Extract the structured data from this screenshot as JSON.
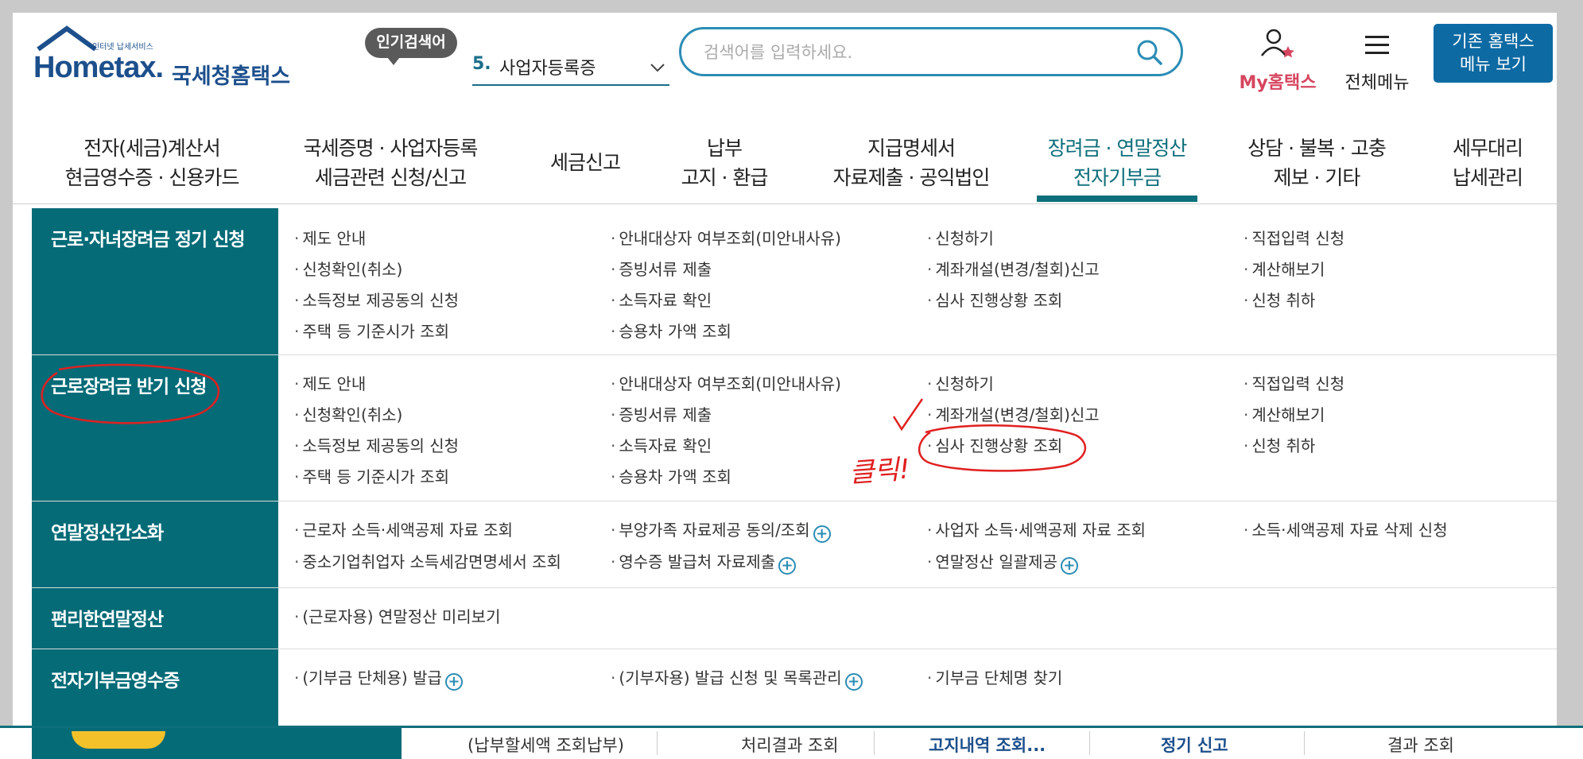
{
  "header": {
    "logo_sub": "인터넷 납세서비스",
    "logo_main": "Hometax.",
    "logo_tail": "국세청홈택스",
    "popular_badge": "인기검색어",
    "popular_rank": "5.",
    "popular_term": "사업자등록증",
    "search_placeholder": "검색어를 입력하세요.",
    "my_label": "My홈택스",
    "allmenu_label": "전체메뉴",
    "legacy_line1": "기존 홈택스",
    "legacy_line2": "메뉴 보기"
  },
  "nav": {
    "items": [
      {
        "line1": "전자(세금)계산서",
        "line2": "현금영수증 · 신용카드"
      },
      {
        "line1": "국세증명 · 사업자등록",
        "line2": "세금관련 신청/신고"
      },
      {
        "line1": "세금신고",
        "line2": ""
      },
      {
        "line1": "납부",
        "line2": "고지 · 환급"
      },
      {
        "line1": "지급명세서",
        "line2": "자료제출 · 공익법인"
      },
      {
        "line1": "장려금 · 연말정산",
        "line2": "전자기부금"
      },
      {
        "line1": "상담 · 불복 · 고충",
        "line2": "제보 · 기타"
      },
      {
        "line1": "세무대리",
        "line2": "납세관리"
      }
    ]
  },
  "menu": {
    "rows": [
      {
        "title": "근로·자녀장려금 정기 신청",
        "links": [
          "제도 안내",
          "안내대상자 여부조회(미안내사유)",
          "신청하기",
          "직접입력 신청",
          "신청확인(취소)",
          "증빙서류 제출",
          "계좌개설(변경/철회)신고",
          "계산해보기",
          "소득정보 제공동의 신청",
          "소득자료 확인",
          "심사 진행상황 조회",
          "신청 취하",
          "주택 등 기준시가 조회",
          "승용차 가액 조회"
        ]
      },
      {
        "title": "근로장려금 반기 신청",
        "links": [
          "제도 안내",
          "안내대상자 여부조회(미안내사유)",
          "신청하기",
          "직접입력 신청",
          "신청확인(취소)",
          "증빙서류 제출",
          "계좌개설(변경/철회)신고",
          "계산해보기",
          "소득정보 제공동의 신청",
          "소득자료 확인",
          "심사 진행상황 조회",
          "신청 취하",
          "주택 등 기준시가 조회",
          "승용차 가액 조회"
        ]
      },
      {
        "title": "연말정산간소화",
        "links": [
          "근로자 소득·세액공제 자료 조회",
          "부양가족 자료제공 동의/조회",
          "사업자 소득·세액공제 자료 조회",
          "소득·세액공제 자료 삭제 신청",
          "중소기업취업자 소득세감면명세서 조회",
          "영수증 발급처 자료제출",
          "연말정산 일괄제공"
        ]
      },
      {
        "title": "편리한연말정산",
        "links": [
          "(근로자용) 연말정산 미리보기"
        ]
      },
      {
        "title": "전자기부금영수증",
        "links": [
          "(기부금 단체용) 발급",
          "(기부자용) 발급 신청 및 목록관리",
          "기부금 단체명 찾기"
        ]
      }
    ]
  },
  "bottom": {
    "items": [
      "(납부할세액 조회납부)",
      "처리결과 조회",
      "고지내역 조회...",
      "정기 신고",
      "결과 조회"
    ]
  },
  "annotation": {
    "handwritten": "클릭!"
  },
  "colors": {
    "teal": "#046b77",
    "accent_blue": "#2b8db5",
    "brand_blue": "#1c4f8c",
    "my_pink": "#d6455f",
    "legacy_btn": "#0d6aa3",
    "annotation_red": "#e02020"
  }
}
